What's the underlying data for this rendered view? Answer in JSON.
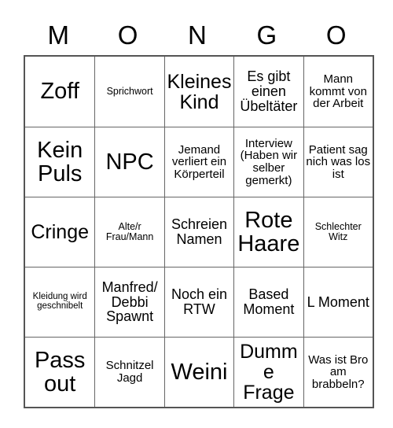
{
  "card": {
    "header_letters": [
      "M",
      "O",
      "N",
      "G",
      "O"
    ],
    "rows": [
      [
        {
          "text": "Zoff",
          "size": "xl"
        },
        {
          "text": "Sprichwort",
          "size": "xs"
        },
        {
          "text": "Kleines Kind",
          "size": "lg"
        },
        {
          "text": "Es gibt einen Übeltäter",
          "size": "md"
        },
        {
          "text": "Mann kommt von der Arbeit",
          "size": "sm"
        }
      ],
      [
        {
          "text": "Kein Puls",
          "size": "xl"
        },
        {
          "text": "NPC",
          "size": "xl"
        },
        {
          "text": "Jemand verliert ein Körperteil",
          "size": "sm"
        },
        {
          "text": "Interview (Haben wir selber gemerkt)",
          "size": "sm"
        },
        {
          "text": "Patient sag nich was los ist",
          "size": "sm"
        }
      ],
      [
        {
          "text": "Cringe",
          "size": "lg"
        },
        {
          "text": "Alte/r Frau/Mann",
          "size": "xs"
        },
        {
          "text": "Schreien Namen",
          "size": "md"
        },
        {
          "text": "Rote Haare",
          "size": "xl"
        },
        {
          "text": "Schlechter Witz",
          "size": "xs"
        }
      ],
      [
        {
          "text": "Kleidung wird geschnibelt",
          "size": "xxs"
        },
        {
          "text": "Manfred/ Debbi Spawnt",
          "size": "md"
        },
        {
          "text": "Noch ein RTW",
          "size": "md"
        },
        {
          "text": "Based Moment",
          "size": "md"
        },
        {
          "text": "L Moment",
          "size": "md"
        }
      ],
      [
        {
          "text": "Pass out",
          "size": "xl"
        },
        {
          "text": "Schnitzel Jagd",
          "size": "sm"
        },
        {
          "text": "Weini",
          "size": "xl"
        },
        {
          "text": "Dumme Frage",
          "size": "lg"
        },
        {
          "text": "Was ist Bro am brabbeln?",
          "size": "sm"
        }
      ]
    ]
  },
  "colors": {
    "background": "#ffffff",
    "text": "#000000",
    "outer_border": "#555555",
    "inner_border": "#666666"
  }
}
